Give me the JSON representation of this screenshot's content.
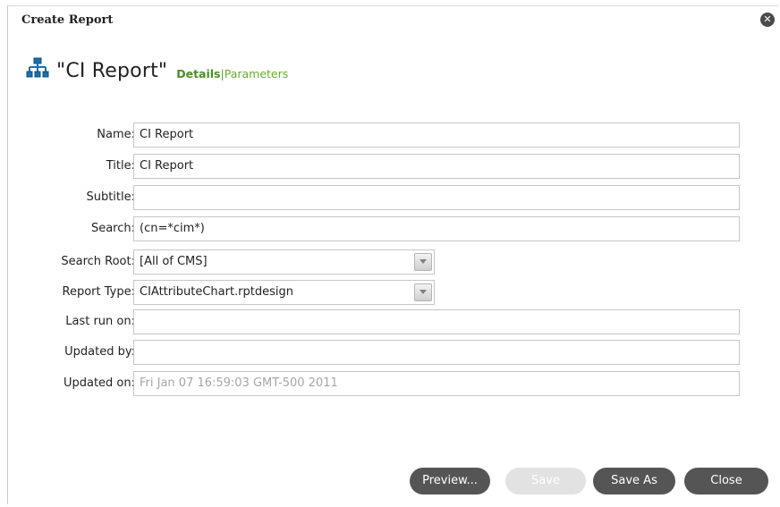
{
  "dialog": {
    "title": "Create Report",
    "close_icon": "close-icon",
    "report_icon": "hierarchy-icon"
  },
  "header": {
    "report_name": "\"CI Report\"",
    "tabs": {
      "details": "Details",
      "separator": "|",
      "parameters": "Parameters"
    }
  },
  "form": {
    "name": {
      "label": "Name:",
      "value": "CI Report"
    },
    "title": {
      "label": "Title:",
      "value": "CI Report"
    },
    "subtitle": {
      "label": "Subtitle:",
      "value": ""
    },
    "search": {
      "label": "Search:",
      "value": "(cn=*cim*)"
    },
    "search_root": {
      "label": "Search Root:",
      "value": "[All of CMS]"
    },
    "report_type": {
      "label": "Report Type:",
      "value": "CIAttributeChart.rptdesign"
    },
    "last_run_on": {
      "label": "Last run on:",
      "value": ""
    },
    "updated_by": {
      "label": "Updated by:",
      "value": ""
    },
    "updated_on": {
      "label": "Updated on:",
      "value": "Fri Jan 07 16:59:03 GMT-500 2011"
    }
  },
  "buttons": {
    "preview": "Preview...",
    "save": "Save",
    "save_as": "Save As",
    "close": "Close"
  },
  "colors": {
    "tab_green": "#4d8f25",
    "button_dark": "#555555",
    "button_disabled": "#e2e2e2"
  }
}
